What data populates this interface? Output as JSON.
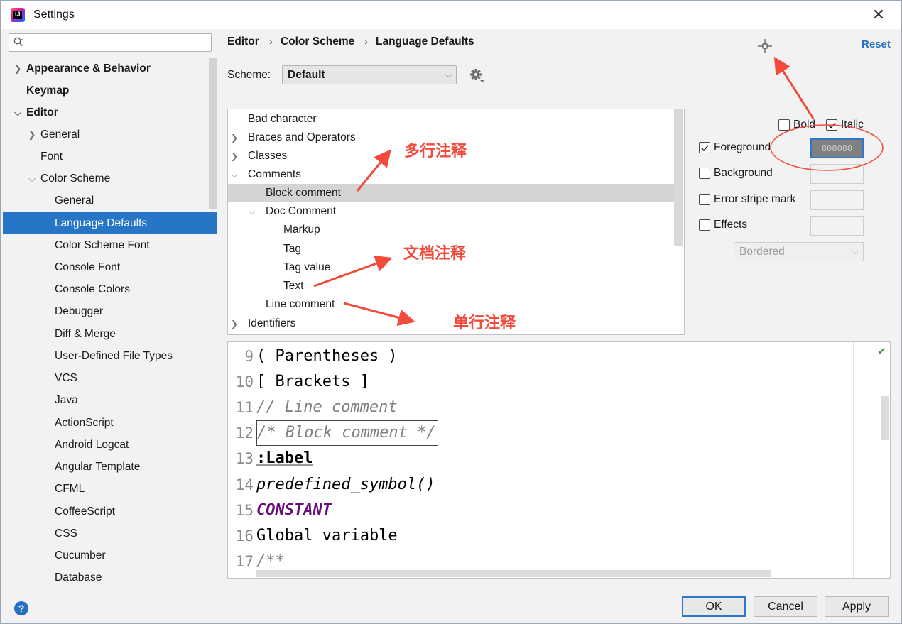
{
  "window": {
    "title": "Settings",
    "close_glyph": "✕"
  },
  "sidebar": {
    "search_placeholder": "",
    "items": [
      {
        "label": "Appearance & Behavior"
      },
      {
        "label": "Keymap"
      },
      {
        "label": "Editor"
      },
      {
        "label": "General"
      },
      {
        "label": "Font"
      },
      {
        "label": "Color Scheme"
      },
      {
        "label": "General"
      },
      {
        "label": "Language Defaults"
      },
      {
        "label": "Color Scheme Font"
      },
      {
        "label": "Console Font"
      },
      {
        "label": "Console Colors"
      },
      {
        "label": "Debugger"
      },
      {
        "label": "Diff & Merge"
      },
      {
        "label": "User-Defined File Types"
      },
      {
        "label": "VCS"
      },
      {
        "label": "Java"
      },
      {
        "label": "ActionScript"
      },
      {
        "label": "Android Logcat"
      },
      {
        "label": "Angular Template"
      },
      {
        "label": "CFML"
      },
      {
        "label": "CoffeeScript"
      },
      {
        "label": "CSS"
      },
      {
        "label": "Cucumber"
      },
      {
        "label": "Database"
      }
    ]
  },
  "breadcrumb": {
    "items": [
      "Editor",
      "Color Scheme",
      "Language Defaults"
    ],
    "separator": "›"
  },
  "header": {
    "reset_label": "Reset"
  },
  "scheme": {
    "label": "Scheme:",
    "selected": "Default"
  },
  "tree": {
    "items": [
      {
        "label": "Bad character"
      },
      {
        "label": "Braces and Operators"
      },
      {
        "label": "Classes"
      },
      {
        "label": "Comments"
      },
      {
        "label": "Block comment"
      },
      {
        "label": "Doc Comment"
      },
      {
        "label": "Markup"
      },
      {
        "label": "Tag"
      },
      {
        "label": "Tag value"
      },
      {
        "label": "Text"
      },
      {
        "label": "Line comment"
      },
      {
        "label": "Identifiers"
      }
    ]
  },
  "attributes": {
    "bold_label": "Bold",
    "bold_checked": false,
    "italic_label": "Italic",
    "italic_checked": true,
    "foreground_label": "Foreground",
    "foreground_checked": true,
    "foreground_value": "808080",
    "background_label": "Background",
    "background_checked": false,
    "error_stripe_label": "Error stripe mark",
    "error_stripe_checked": false,
    "effects_label": "Effects",
    "effects_checked": false,
    "effects_type": "Bordered"
  },
  "preview": {
    "lines": [
      {
        "num": "9",
        "code": "( Parentheses )"
      },
      {
        "num": "10",
        "code": "[ Brackets ]"
      },
      {
        "num": "11",
        "code": "// Line comment"
      },
      {
        "num": "12",
        "code": "/* Block comment */"
      },
      {
        "num": "13",
        "code": ":Label"
      },
      {
        "num": "14",
        "code": "predefined_symbol()"
      },
      {
        "num": "15",
        "code": "CONSTANT"
      },
      {
        "num": "16",
        "code": "Global variable"
      },
      {
        "num": "17",
        "code": "/**"
      }
    ]
  },
  "buttons": {
    "ok": "OK",
    "cancel": "Cancel",
    "apply": "Apply",
    "help": "?"
  },
  "annotations": {
    "multiline": "多行注释",
    "doc": "文档注释",
    "single": "单行注释"
  },
  "colors": {
    "accent": "#2675c6",
    "annotation": "#f24b3c",
    "comment_gray": "#808080",
    "constant_purple": "#660e7a"
  }
}
